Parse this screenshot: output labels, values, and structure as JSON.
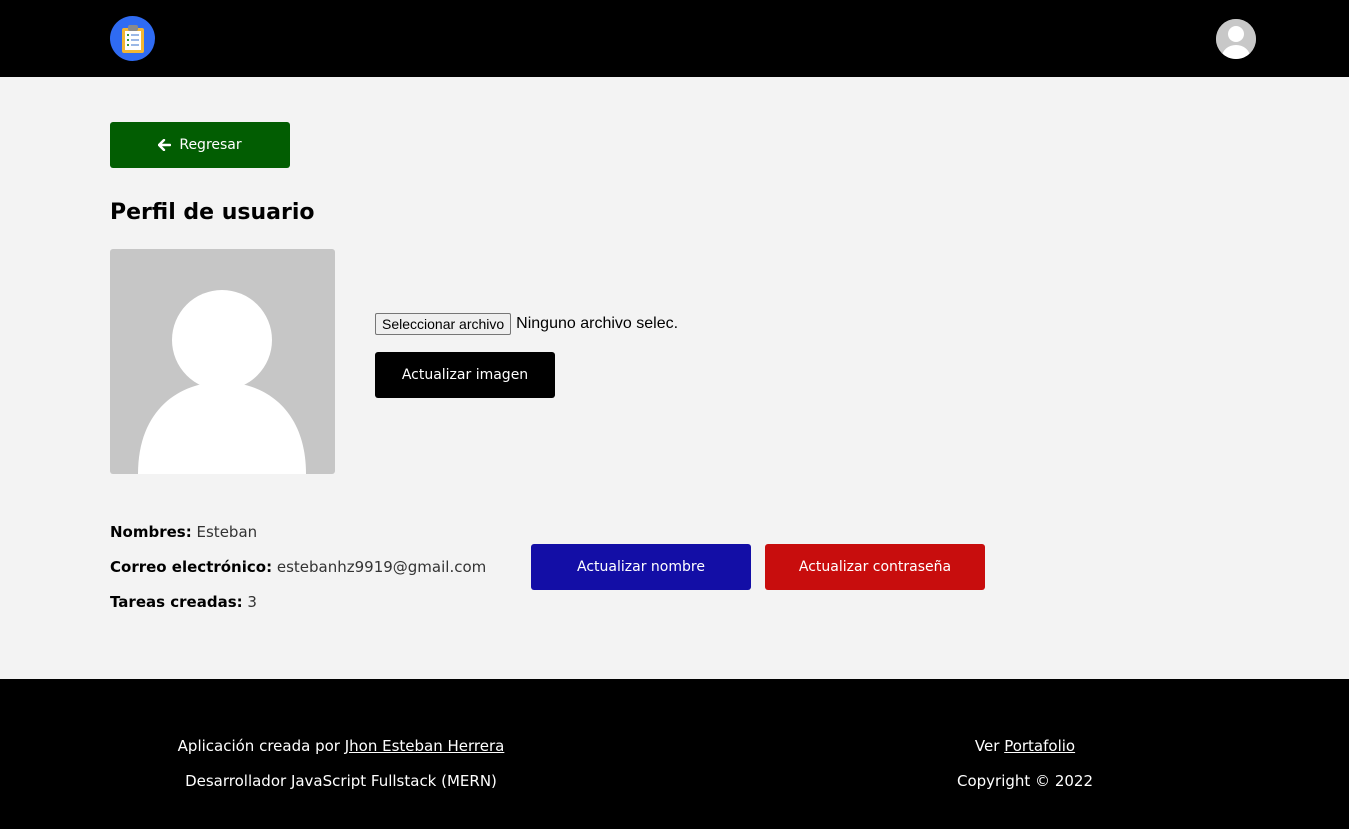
{
  "header": {
    "logo_icon": "clipboard-icon",
    "avatar_icon": "user-avatar-icon",
    "logo_color": "#2f6bf2"
  },
  "main": {
    "back_label": "Regresar",
    "title": "Perfil de usuario",
    "file_button_label": "Seleccionar archivo",
    "file_status": "Ninguno archivo selec.",
    "update_image_label": "Actualizar imagen",
    "info": {
      "name_label": "Nombres:",
      "name_value": "Esteban",
      "email_label": "Correo electrónico:",
      "email_value": "estebanhz9919@gmail.com",
      "tasks_label": "Tareas creadas:",
      "tasks_value": "3"
    },
    "update_name_label": "Actualizar nombre",
    "update_password_label": "Actualizar contraseña",
    "colors": {
      "back": "#025d02",
      "update_name": "#130ea6",
      "update_password": "#c80d0d"
    }
  },
  "footer": {
    "created_by_text": "Aplicación creada por",
    "author_link": "Jhon Esteban Herrera",
    "role": "Desarrollador JavaScript Fullstack (MERN)",
    "view_text": "Ver",
    "portfolio_link": "Portafolio",
    "copyright": "Copyright © 2022"
  }
}
